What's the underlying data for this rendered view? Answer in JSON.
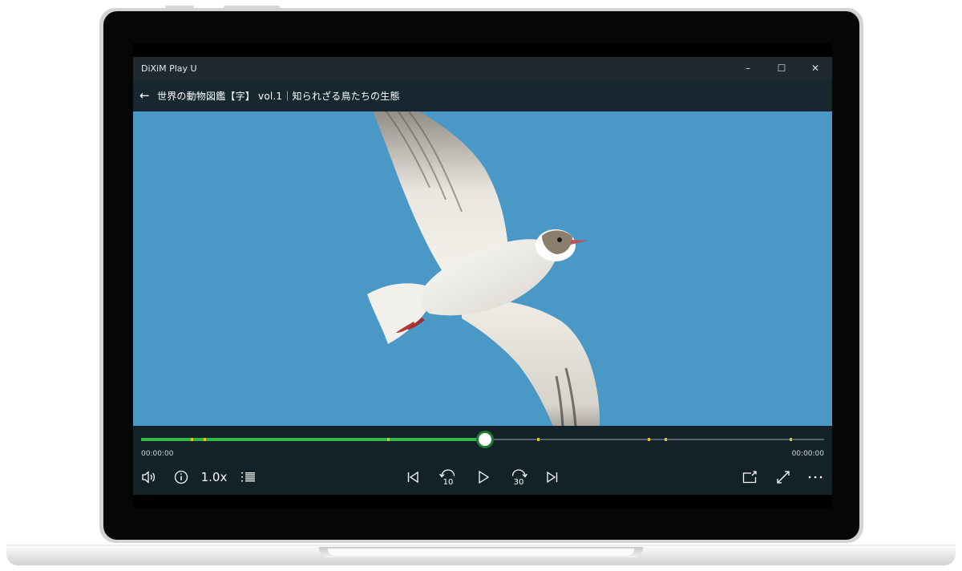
{
  "window": {
    "app_name": "DiXiM Play U",
    "minimize_glyph": "–",
    "maximize_glyph": "☐",
    "close_glyph": "✕"
  },
  "header": {
    "back_glyph": "←",
    "title": "世界の動物図鑑【字】 vol.1｜知られざる鳥たちの生態"
  },
  "playback": {
    "progress_fraction": 0.503,
    "time_elapsed": "00:00:00",
    "time_total": "00:00:00",
    "chapter_markers": [
      0.073,
      0.092,
      0.36,
      0.58,
      0.742,
      0.766,
      0.95
    ],
    "speed_label": "1.0x",
    "skip_back_seconds": "10",
    "skip_forward_seconds": "30"
  },
  "colors": {
    "progress": "#31b54a",
    "marker": "#e5c21a",
    "sky": "#4a98c5",
    "panel": "#132128"
  },
  "icons": [
    "volume-icon",
    "info-icon",
    "playlist-icon",
    "previous-track-icon",
    "rewind-10-icon",
    "play-icon",
    "forward-30-icon",
    "next-track-icon",
    "cast-icon",
    "fullscreen-icon",
    "more-icon"
  ]
}
